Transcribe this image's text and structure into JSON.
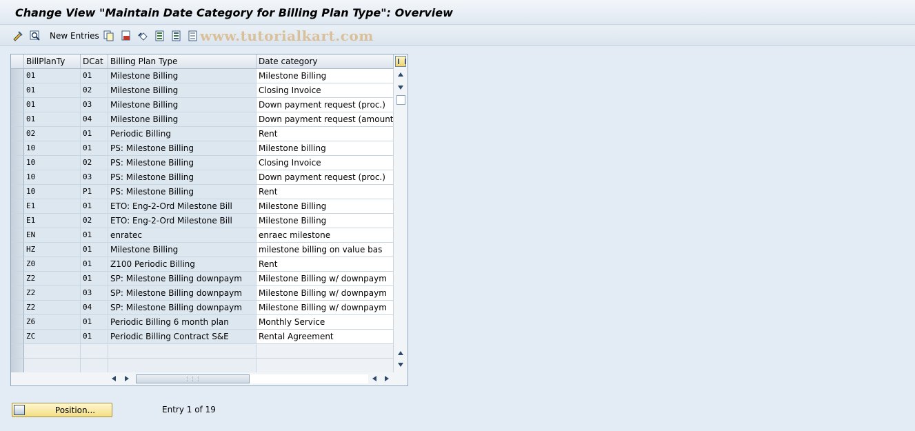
{
  "window": {
    "title": "Change View \"Maintain Date Category for Billing Plan Type\": Overview"
  },
  "toolbar": {
    "new_entries_label": "New Entries",
    "watermark": "www.tutorialkart.com"
  },
  "table": {
    "columns": [
      "BillPlanTy",
      "DCat",
      "Billing Plan Type",
      "Date category"
    ],
    "rows": [
      {
        "plan": "01",
        "dcat": "01",
        "type": "Milestone Billing",
        "date": "Milestone Billing"
      },
      {
        "plan": "01",
        "dcat": "02",
        "type": "Milestone Billing",
        "date": "Closing Invoice"
      },
      {
        "plan": "01",
        "dcat": "03",
        "type": "Milestone Billing",
        "date": "Down payment request (proc.)"
      },
      {
        "plan": "01",
        "dcat": "04",
        "type": "Milestone Billing",
        "date": "Down payment request (amount)"
      },
      {
        "plan": "02",
        "dcat": "01",
        "type": "Periodic Billing",
        "date": "Rent"
      },
      {
        "plan": "10",
        "dcat": "01",
        "type": "PS: Milestone Billing",
        "date": "Milestone billing"
      },
      {
        "plan": "10",
        "dcat": "02",
        "type": "PS: Milestone Billing",
        "date": "Closing Invoice"
      },
      {
        "plan": "10",
        "dcat": "03",
        "type": "PS: Milestone Billing",
        "date": "Down payment request (proc.)"
      },
      {
        "plan": "10",
        "dcat": "P1",
        "type": "PS: Milestone Billing",
        "date": "Rent"
      },
      {
        "plan": "E1",
        "dcat": "01",
        "type": "ETO: Eng-2-Ord Milestone Bill",
        "date": "Milestone Billing"
      },
      {
        "plan": "E1",
        "dcat": "02",
        "type": "ETO: Eng-2-Ord Milestone Bill",
        "date": "Milestone Billing"
      },
      {
        "plan": "EN",
        "dcat": "01",
        "type": "enratec",
        "date": "enraec milestone"
      },
      {
        "plan": "HZ",
        "dcat": "01",
        "type": "Milestone Billing",
        "date": "milestone billing on value bas"
      },
      {
        "plan": "Z0",
        "dcat": "01",
        "type": "Z100 Periodic Billing",
        "date": "Rent"
      },
      {
        "plan": "Z2",
        "dcat": "01",
        "type": "SP: Milestone Billing downpaym",
        "date": "Milestone Billing w/ downpaym"
      },
      {
        "plan": "Z2",
        "dcat": "03",
        "type": "SP: Milestone Billing downpaym",
        "date": "Milestone Billing w/ downpaym"
      },
      {
        "plan": "Z2",
        "dcat": "04",
        "type": "SP: Milestone Billing downpaym",
        "date": "Milestone Billing w/ downpaym"
      },
      {
        "plan": "Z6",
        "dcat": "01",
        "type": "Periodic Billing 6 month plan",
        "date": "Monthly Service"
      },
      {
        "plan": "ZC",
        "dcat": "01",
        "type": "Periodic Billing Contract S&E",
        "date": "Rental Agreement"
      }
    ]
  },
  "footer": {
    "position_label": "Position...",
    "entry_info": "Entry 1 of 19"
  },
  "colors": {
    "background": "#e3ecf4",
    "key_cell": "#dde7f0",
    "button": "#f3df84"
  }
}
